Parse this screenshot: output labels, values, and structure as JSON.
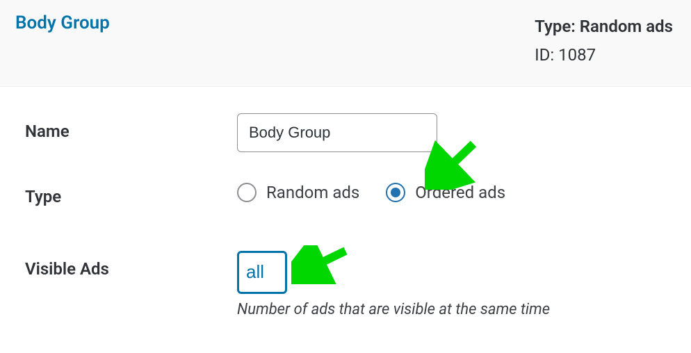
{
  "header": {
    "title": "Body Group",
    "type_label": "Type:",
    "type_value": "Random ads",
    "id_label": "ID:",
    "id_value": "1087"
  },
  "form": {
    "name_label": "Name",
    "name_value": "Body Group",
    "type_label": "Type",
    "type_options": {
      "random": "Random ads",
      "ordered": "Ordered ads"
    },
    "visible_label": "Visible Ads",
    "visible_value": "all",
    "visible_hint": "Number of ads that are visible at the same time"
  }
}
